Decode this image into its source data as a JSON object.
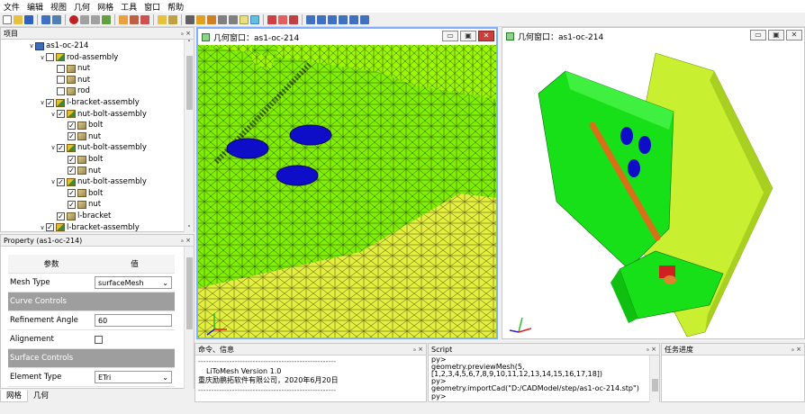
{
  "menu": [
    "文件",
    "编辑",
    "视图",
    "几何",
    "网格",
    "工具",
    "窗口",
    "帮助"
  ],
  "tree_panel": {
    "title": "项目",
    "items": [
      {
        "label": "as1-oc-214",
        "level": 0,
        "arrow": "∨",
        "checkbox": false,
        "icon": "root-icon",
        "checked": ""
      },
      {
        "label": "rod-assembly",
        "level": 1,
        "arrow": "∨",
        "checkbox": true,
        "icon": "assembly-icon",
        "checked": ""
      },
      {
        "label": "nut",
        "level": 2,
        "arrow": "",
        "checkbox": true,
        "icon": "part-icon",
        "checked": ""
      },
      {
        "label": "nut",
        "level": 2,
        "arrow": "",
        "checkbox": true,
        "icon": "part-icon",
        "checked": ""
      },
      {
        "label": "rod",
        "level": 2,
        "arrow": "",
        "checkbox": true,
        "icon": "part-icon",
        "checked": ""
      },
      {
        "label": "l-bracket-assembly",
        "level": 1,
        "arrow": "∨",
        "checkbox": true,
        "icon": "assembly-icon",
        "checked": "✓"
      },
      {
        "label": "nut-bolt-assembly",
        "level": 2,
        "arrow": "∨",
        "checkbox": true,
        "icon": "assembly-icon",
        "checked": "✓"
      },
      {
        "label": "bolt",
        "level": 3,
        "arrow": "",
        "checkbox": true,
        "icon": "part-icon",
        "checked": "✓"
      },
      {
        "label": "nut",
        "level": 3,
        "arrow": "",
        "checkbox": true,
        "icon": "part-icon",
        "checked": "✓"
      },
      {
        "label": "nut-bolt-assembly",
        "level": 2,
        "arrow": "∨",
        "checkbox": true,
        "icon": "assembly-icon",
        "checked": "✓"
      },
      {
        "label": "bolt",
        "level": 3,
        "arrow": "",
        "checkbox": true,
        "icon": "part-icon",
        "checked": "✓"
      },
      {
        "label": "nut",
        "level": 3,
        "arrow": "",
        "checkbox": true,
        "icon": "part-icon",
        "checked": "✓"
      },
      {
        "label": "nut-bolt-assembly",
        "level": 2,
        "arrow": "∨",
        "checkbox": true,
        "icon": "assembly-icon",
        "checked": "✓"
      },
      {
        "label": "bolt",
        "level": 3,
        "arrow": "",
        "checkbox": true,
        "icon": "part-icon",
        "checked": "✓"
      },
      {
        "label": "nut",
        "level": 3,
        "arrow": "",
        "checkbox": true,
        "icon": "part-icon",
        "checked": "✓"
      },
      {
        "label": "l-bracket",
        "level": 2,
        "arrow": "",
        "checkbox": true,
        "icon": "part-icon",
        "checked": "✓"
      },
      {
        "label": "l-bracket-assembly",
        "level": 1,
        "arrow": "∨",
        "checkbox": true,
        "icon": "assembly-icon",
        "checked": "✓"
      }
    ]
  },
  "property_panel": {
    "title": "Property (as1-oc-214)",
    "header": {
      "param": "参数",
      "value": "值"
    },
    "mesh_type_label": "Mesh Type",
    "mesh_type_value": "surfaceMesh",
    "curve_controls": "Curve Controls",
    "refinement_label": "Refinement Angle",
    "refinement_value": "60",
    "alignement_label": "Alignement",
    "surface_controls": "Surface Controls",
    "element_type_label": "Element Type",
    "element_type_value": "ETri"
  },
  "bottom_tabs": [
    "网格",
    "几何"
  ],
  "left_view": {
    "title": "几何窗口：as1-oc-214"
  },
  "right_view": {
    "title": "几何窗口：as1-oc-214"
  },
  "window_buttons": {
    "minimize": "▭",
    "restore": "▣",
    "close": "✕"
  },
  "panel_controls": "ₔ ×",
  "msg_panel": {
    "title": "命令、信息",
    "lines": [
      "-----------------------------------------------------",
      "LiToMesh Version 1.0",
      "重庆励鹏拓软件有限公司，2020年6月20日",
      "-----------------------------------------------------"
    ]
  },
  "script_panel": {
    "title": "Script",
    "lines": [
      "py>",
      "geometry.previewMesh(5,",
      "[1,2,3,4,5,6,7,8,9,10,11,12,13,14,15,16,17,18])",
      "py>",
      "geometry.importCad(\"D:/CADModel/step/as1-oc-214.stp\")",
      "py>"
    ]
  },
  "task_panel": {
    "title": "任务进度"
  },
  "colors": {
    "mesh_green": "#80f000",
    "mesh_yellow": "#e4f040",
    "bolt_blue": "#1010c8",
    "plate_green": "#18e018",
    "plate_lime": "#c8f030",
    "rod_orange": "#d8701a",
    "view_bg": "#ffffff"
  }
}
